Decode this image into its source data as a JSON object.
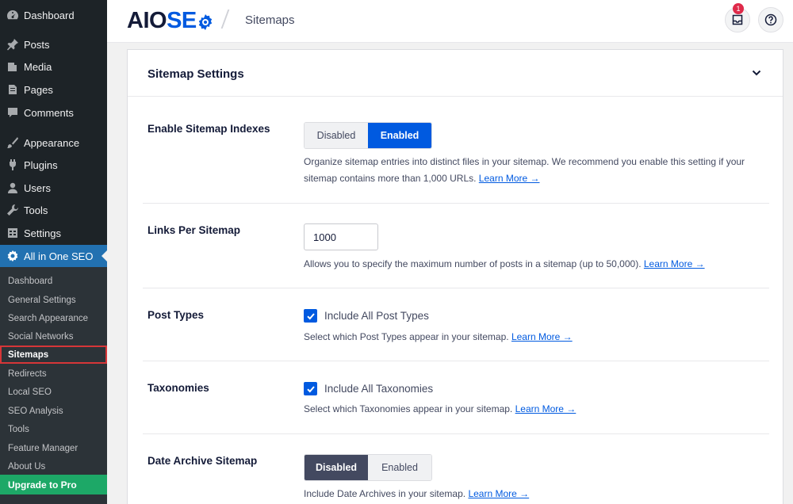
{
  "sidebar": {
    "menu": [
      {
        "label": "Dashboard",
        "icon": "dashboard-icon"
      },
      {
        "label": "Posts",
        "icon": "pin-icon"
      },
      {
        "label": "Media",
        "icon": "media-icon"
      },
      {
        "label": "Pages",
        "icon": "pages-icon"
      },
      {
        "label": "Comments",
        "icon": "comment-icon"
      },
      {
        "label": "Appearance",
        "icon": "brush-icon"
      },
      {
        "label": "Plugins",
        "icon": "plugin-icon"
      },
      {
        "label": "Users",
        "icon": "user-icon"
      },
      {
        "label": "Tools",
        "icon": "wrench-icon"
      },
      {
        "label": "Settings",
        "icon": "settings-icon"
      },
      {
        "label": "All in One SEO",
        "icon": "aioseo-icon"
      }
    ],
    "submenu": [
      "Dashboard",
      "General Settings",
      "Search Appearance",
      "Social Networks",
      "Sitemaps",
      "Redirects",
      "Local SEO",
      "SEO Analysis",
      "Tools",
      "Feature Manager",
      "About Us"
    ],
    "upgrade_label": "Upgrade to Pro"
  },
  "header": {
    "logo_aio": "AIO",
    "logo_seo": "SE",
    "breadcrumb": "Sitemaps",
    "notification_count": "1"
  },
  "card": {
    "title": "Sitemap Settings",
    "rows": {
      "indexes": {
        "label": "Enable Sitemap Indexes",
        "options": [
          "Disabled",
          "Enabled"
        ],
        "selected": "Enabled",
        "desc": "Organize sitemap entries into distinct files in your sitemap. We recommend you enable this setting if your sitemap contains more than 1,000 URLs.",
        "link": "Learn More →"
      },
      "links": {
        "label": "Links Per Sitemap",
        "value": "1000",
        "desc": "Allows you to specify the maximum number of posts in a sitemap (up to 50,000).",
        "link": "Learn More →"
      },
      "post_types": {
        "label": "Post Types",
        "checkbox": "Include All Post Types",
        "desc": "Select which Post Types appear in your sitemap.",
        "link": "Learn More →"
      },
      "taxonomies": {
        "label": "Taxonomies",
        "checkbox": "Include All Taxonomies",
        "desc": "Select which Taxonomies appear in your sitemap.",
        "link": "Learn More →"
      },
      "date_archive": {
        "label": "Date Archive Sitemap",
        "options": [
          "Disabled",
          "Enabled"
        ],
        "selected": "Disabled",
        "desc": "Include Date Archives in your sitemap.",
        "link": "Learn More →"
      }
    }
  },
  "colors": {
    "sidebar_bg": "#1d2327",
    "active_menu": "#2271b1",
    "brand_blue": "#005ae0",
    "upgrade_green": "#1da867",
    "highlight_red": "#d63638"
  }
}
